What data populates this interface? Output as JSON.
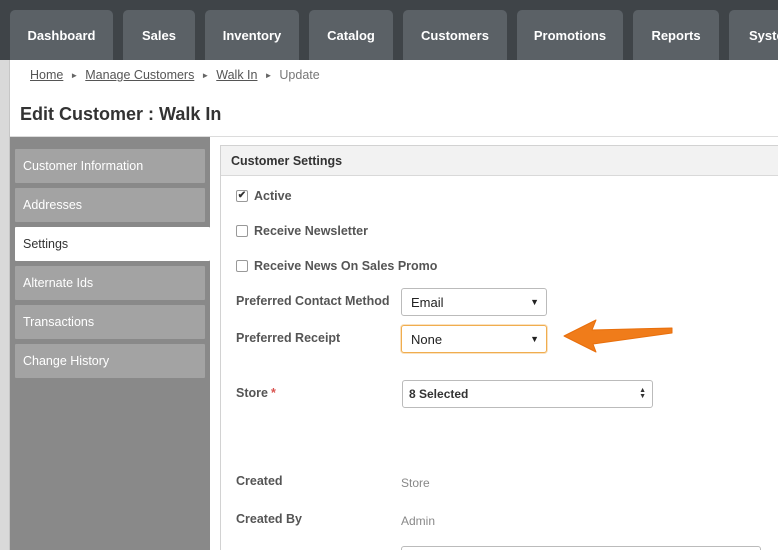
{
  "nav": {
    "tabs": [
      {
        "label": "Dashboard"
      },
      {
        "label": "Sales"
      },
      {
        "label": "Inventory"
      },
      {
        "label": "Catalog"
      },
      {
        "label": "Customers"
      },
      {
        "label": "Promotions"
      },
      {
        "label": "Reports"
      },
      {
        "label": "Syste"
      }
    ]
  },
  "breadcrumb": {
    "home": "Home",
    "manage": "Manage Customers",
    "customer": "Walk In",
    "current": "Update"
  },
  "page": {
    "title": "Edit Customer : Walk In"
  },
  "sidebar": {
    "items": [
      {
        "label": "Customer Information"
      },
      {
        "label": "Addresses"
      },
      {
        "label": "Settings"
      },
      {
        "label": "Alternate Ids"
      },
      {
        "label": "Transactions"
      },
      {
        "label": "Change History"
      }
    ],
    "active_index": 2
  },
  "panel": {
    "title": "Customer Settings",
    "active": {
      "label": "Active",
      "checked": true
    },
    "newsletter": {
      "label": "Receive Newsletter",
      "checked": false
    },
    "promo": {
      "label": "Receive News On Sales Promo",
      "checked": false
    },
    "contact_method": {
      "label": "Preferred Contact Method",
      "value": "Email"
    },
    "receipt": {
      "label": "Preferred Receipt",
      "value": "None"
    },
    "store": {
      "label": "Store",
      "required_mark": "*",
      "value": "8 Selected"
    },
    "created": {
      "label": "Created",
      "value": "Store"
    },
    "created_by": {
      "label": "Created By",
      "value": "Admin"
    }
  },
  "colors": {
    "topbar": "#3f4448",
    "tab": "#5b6166",
    "sidebar": "#898989",
    "sidebar_item": "#a3a3a3",
    "arrow": "#f07c1a",
    "focus": "#f0ad4e"
  },
  "icons": {
    "breadcrumb_separator": "triangle-right-icon",
    "select_caret": "caret-down-icon",
    "annotation_arrow": "arrow-left-icon",
    "checkbox_check": "check-icon"
  }
}
